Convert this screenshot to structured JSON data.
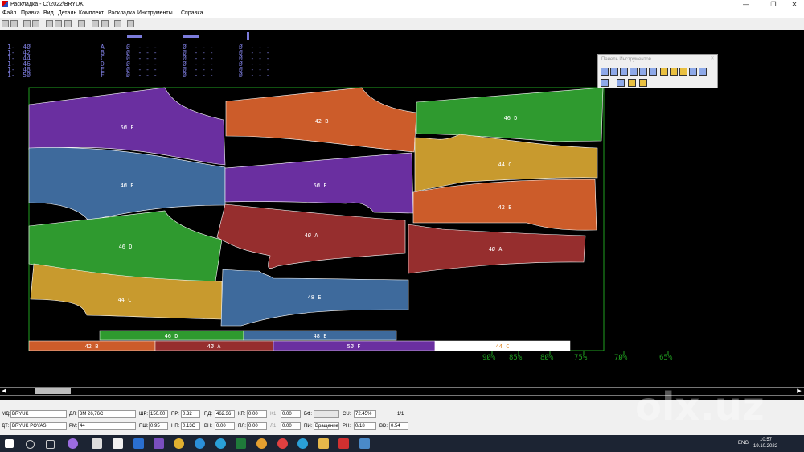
{
  "window": {
    "title": "Раскладка - C:\\2022\\BRYUK",
    "minimize": "—",
    "maximize": "❐",
    "close": "✕"
  },
  "menu": [
    "Файл",
    "Правка",
    "Вид",
    "Деталь",
    "Комплект",
    "Раскладка",
    "Инструменты",
    "Справка"
  ],
  "size_table": [
    {
      "size": "1-  4Ø",
      "code": "A",
      "c1": "Ø  - - -",
      "c2": "Ø  - - -",
      "c3": "Ø  - - -"
    },
    {
      "size": "1-  42",
      "code": "B",
      "c1": "Ø  - - -",
      "c2": "Ø  - - -",
      "c3": "Ø  - - -"
    },
    {
      "size": "1-  44",
      "code": "C",
      "c1": "Ø  - - -",
      "c2": "Ø  - - -",
      "c3": "Ø  - - -"
    },
    {
      "size": "1-  46",
      "code": "D",
      "c1": "Ø  - - -",
      "c2": "Ø  - - -",
      "c3": "Ø  - - -"
    },
    {
      "size": "1-  48",
      "code": "E",
      "c1": "Ø  - - -",
      "c2": "Ø  - - -",
      "c3": "Ø  - - -"
    },
    {
      "size": "1-  5Ø",
      "code": "F",
      "c1": "Ø  - - -",
      "c2": "Ø  - - -",
      "c3": "Ø  - - -"
    }
  ],
  "pieces": [
    {
      "label": "5Ø  F",
      "color": "#6a2fa0"
    },
    {
      "label": "42  B",
      "color": "#cc5c2a"
    },
    {
      "label": "46  D",
      "color": "#2f9a2f"
    },
    {
      "label": "4Ø  E",
      "color": "#3e6a9c"
    },
    {
      "label": "5Ø  F",
      "color": "#6a2fa0"
    },
    {
      "label": "44  C",
      "color": "#c89a2e"
    },
    {
      "label": "42  B",
      "color": "#cc5c2a"
    },
    {
      "label": "46  D",
      "color": "#2f9a2f"
    },
    {
      "label": "4Ø  A",
      "color": "#962e2e"
    },
    {
      "label": "4Ø  A",
      "color": "#962e2e"
    },
    {
      "label": "44  C",
      "color": "#c89a2e"
    },
    {
      "label": "48  E",
      "color": "#3e6a9c"
    }
  ],
  "bars": [
    {
      "label": "46  D",
      "color": "#2f9a2f"
    },
    {
      "label": "48  E",
      "color": "#3e6a9c"
    },
    {
      "label": "42  B",
      "color": "#cc5c2a"
    },
    {
      "label": "4Ø  A",
      "color": "#962e2e"
    },
    {
      "label": "5Ø  F",
      "color": "#6a2fa0"
    },
    {
      "label": "44  C",
      "color": "#ffffff",
      "text_color": "#e08a2a"
    }
  ],
  "efficiency_marks": [
    "9Ø%",
    "85%",
    "8Ø%",
    "75%",
    "7Ø%",
    "65%"
  ],
  "tool_palette": {
    "title": "Панель Инструментов",
    "close": "✕"
  },
  "status": {
    "md_label": "МД:",
    "md_value": "BRYUK",
    "dl_label": "ДЛ:",
    "dl_value": "3M 26,76C",
    "dt_label": "ДТ:",
    "dt_value": "BRYUK POYAS",
    "rm_label": "РМ:",
    "rm_value": "44",
    "shr_label": "ШР:",
    "shr_value": "150.00",
    "psh_label": "ПШ:",
    "psh_value": "0.95",
    "pr_label": "ПР:",
    "pr_value": "0.32",
    "np_label": "НП:",
    "np_value": "0.13C",
    "pd_label": "ПД:",
    "pd_value": "462.36",
    "vn_label": "ВН:",
    "vn_value": "0.00",
    "kp_label": "КП:",
    "kp_value": "0.00",
    "pl_label": "ПЛ:",
    "pl_value": "0.00",
    "k1_label": "K1",
    "k1_value": "0.00",
    "l1_label": "Л1",
    "l1_value": "0.00",
    "bf_label": "БФ:",
    "bf_value": "",
    "pi_label": "ПИ:",
    "pi_value": "Вращение 9",
    "cu_label": "CU:",
    "cu_value": "72.45%",
    "rn_label": "РН:",
    "rn_value": "0/18",
    "vd_label": "ВD:",
    "vd_value": "0.54",
    "page": "1/1"
  },
  "tray": {
    "lang": "ENG",
    "time": "10:57",
    "date": "19.10.2022"
  },
  "watermark": "olx.uz"
}
